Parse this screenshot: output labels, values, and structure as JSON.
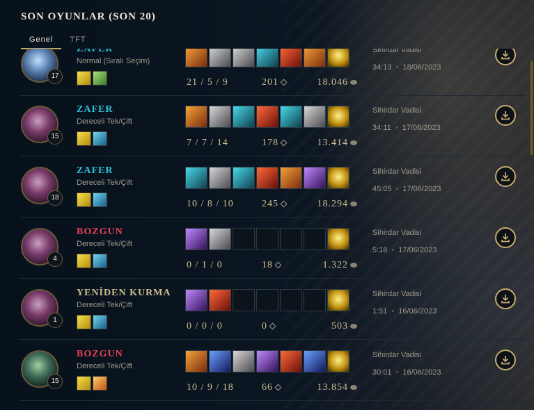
{
  "header": {
    "title": "SON OYUNLAR (SON 20)"
  },
  "tabs": [
    {
      "label": "Genel",
      "active": true
    },
    {
      "label": "TFT",
      "active": false
    }
  ],
  "colors": {
    "win": "#2fc1d8",
    "loss": "#e84057",
    "remake": "#cdbe91",
    "accent": "#c8aa6e"
  },
  "matches": [
    {
      "result": "ZAFER",
      "mode": "Normal (Sıralı Seçim)",
      "level": "17",
      "champion": "jinx-avatar",
      "spells": [
        "flash",
        "heal"
      ],
      "items": [
        "orange",
        "silver",
        "silver",
        "teal",
        "red",
        "orange",
        "gold"
      ],
      "kda": "21 / 5 / 9",
      "cs": "201",
      "gold": "18.046",
      "map": "Sihirdar Vadisi",
      "duration": "34:13",
      "date": "18/06/2023"
    },
    {
      "result": "ZAFER",
      "mode": "Dereceli Tek/Çift",
      "level": "15",
      "champion": "vayne-avatar",
      "spells": [
        "flash",
        "ghost"
      ],
      "items": [
        "orange",
        "silver",
        "teal",
        "red",
        "teal",
        "silver",
        "gold"
      ],
      "kda": "7 / 7 / 14",
      "cs": "178",
      "gold": "13.414",
      "map": "Sihirdar Vadisi",
      "duration": "34:11",
      "date": "17/06/2023"
    },
    {
      "result": "ZAFER",
      "mode": "Dereceli Tek/Çift",
      "level": "18",
      "champion": "vayne-avatar",
      "spells": [
        "flash",
        "ghost"
      ],
      "items": [
        "teal",
        "silver",
        "teal",
        "red",
        "orange",
        "purple",
        "gold"
      ],
      "kda": "10 / 8 / 10",
      "cs": "245",
      "gold": "18.294",
      "map": "Sihirdar Vadisi",
      "duration": "45:05",
      "date": "17/06/2023"
    },
    {
      "result": "BOZGUN",
      "mode": "Dereceli Tek/Çift",
      "level": "4",
      "champion": "vayne-avatar",
      "spells": [
        "flash",
        "ghost"
      ],
      "items": [
        "purple",
        "silver",
        "empty",
        "empty",
        "empty",
        "empty",
        "gold"
      ],
      "kda": "0 / 1 / 0",
      "cs": "18",
      "gold": "1.322",
      "map": "Sihirdar Vadisi",
      "duration": "5:18",
      "date": "17/06/2023"
    },
    {
      "result": "YENİDEN KURMA",
      "mode": "Dereceli Tek/Çift",
      "level": "1",
      "champion": "vayne-avatar",
      "spells": [
        "flash",
        "ghost"
      ],
      "items": [
        "purple",
        "red",
        "empty",
        "empty",
        "empty",
        "empty",
        "gold"
      ],
      "kda": "0 / 0 / 0",
      "cs": "0",
      "gold": "503",
      "map": "Sihirdar Vadisi",
      "duration": "1:51",
      "date": "16/06/2023"
    },
    {
      "result": "BOZGUN",
      "mode": "Dereceli Tek/Çift",
      "level": "15",
      "champion": "senna-avatar",
      "spells": [
        "flash",
        "ignite"
      ],
      "items": [
        "orange",
        "blue",
        "silver",
        "purple",
        "red",
        "blue",
        "gold"
      ],
      "kda": "10 / 9 / 18",
      "cs": "66",
      "gold": "13.854",
      "map": "Sihirdar Vadisi",
      "duration": "30:01",
      "date": "16/06/2023"
    }
  ]
}
